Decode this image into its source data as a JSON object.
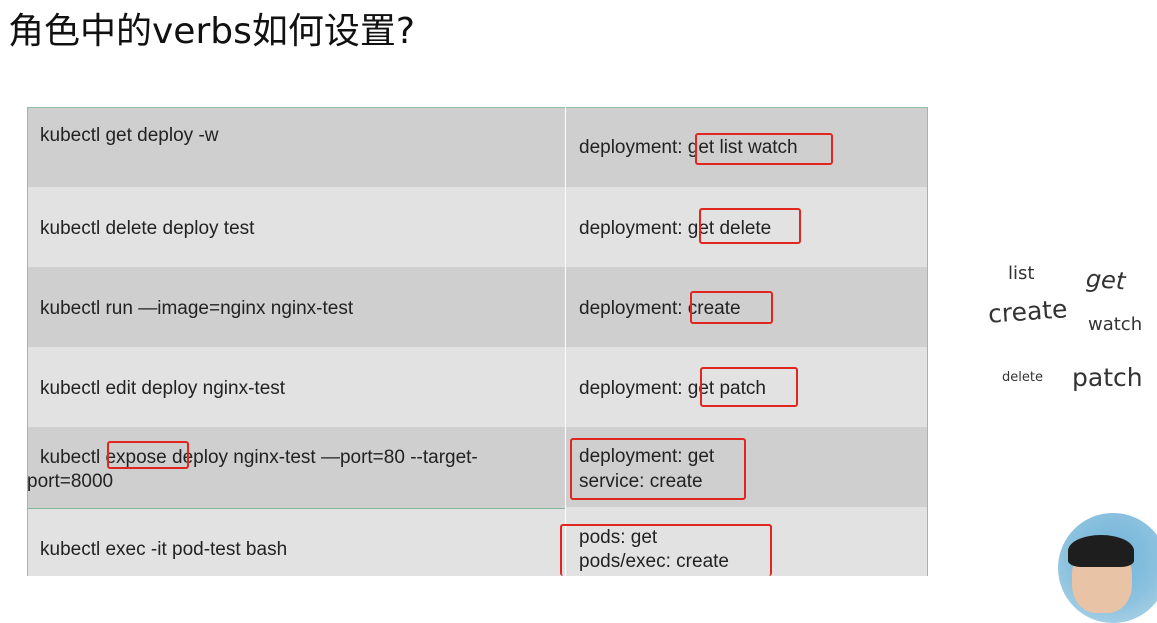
{
  "slide": {
    "title": "角色中的verbs如何设置?"
  },
  "table": {
    "rows": [
      {
        "command": "kubectl get deploy -w",
        "permission": [
          "deployment: get list watch"
        ]
      },
      {
        "command": "kubectl delete deploy test",
        "permission": [
          "deployment: get delete"
        ]
      },
      {
        "command": "kubectl run —image=nginx nginx-test",
        "permission": [
          "deployment: create"
        ]
      },
      {
        "command": "kubectl edit deploy nginx-test",
        "permission": [
          "deployment: get patch"
        ]
      },
      {
        "command_line1": "kubectl expose deploy nginx-test —port=80 --target-",
        "command_line2": "port=8000",
        "permission": [
          "deployment: get",
          "service: create"
        ]
      },
      {
        "command": "kubectl exec -it pod-test bash",
        "permission": [
          "pods: get",
          "pods/exec: create"
        ]
      }
    ]
  },
  "word_cloud": [
    "list",
    "get",
    "create",
    "watch",
    "delete",
    "patch"
  ],
  "colors": {
    "highlight": "#e0261f",
    "row_dark": "#cfcfcf",
    "row_light": "#e2e2e2"
  }
}
